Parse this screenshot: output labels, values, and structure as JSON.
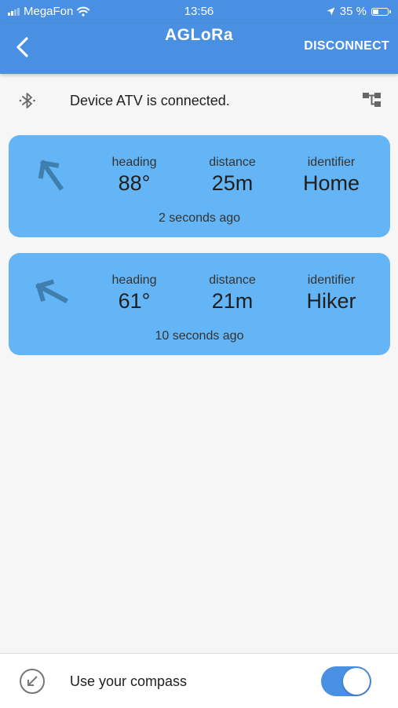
{
  "status_bar": {
    "carrier": "MegaFon",
    "time": "13:56",
    "battery": "35 %",
    "battery_level": 0.35
  },
  "app_bar": {
    "title": "AGLoRa",
    "disconnect_label": "DISCONNECT"
  },
  "connection": {
    "message": "Device ATV is connected."
  },
  "targets": [
    {
      "heading_label": "heading",
      "heading_value": "88°",
      "heading_degrees": 88,
      "distance_label": "distance",
      "distance_value": "25m",
      "identifier_label": "identifier",
      "identifier_value": "Home",
      "updated": "2 seconds ago"
    },
    {
      "heading_label": "heading",
      "heading_value": "61°",
      "heading_degrees": 61,
      "distance_label": "distance",
      "distance_value": "21m",
      "identifier_label": "identifier",
      "identifier_value": "Hiker",
      "updated": "10 seconds ago"
    }
  ],
  "compass_setting": {
    "label": "Use your compass",
    "enabled": true
  },
  "colors": {
    "primary": "#4a90e2",
    "card": "#64b5f6",
    "arrow": "#3f7fb0"
  },
  "icons": {
    "back": "chevron-left-icon",
    "bluetooth": "bluetooth-icon",
    "device_tree": "device-tree-icon",
    "target_arrow": "direction-arrow-icon",
    "compass": "compass-icon"
  }
}
